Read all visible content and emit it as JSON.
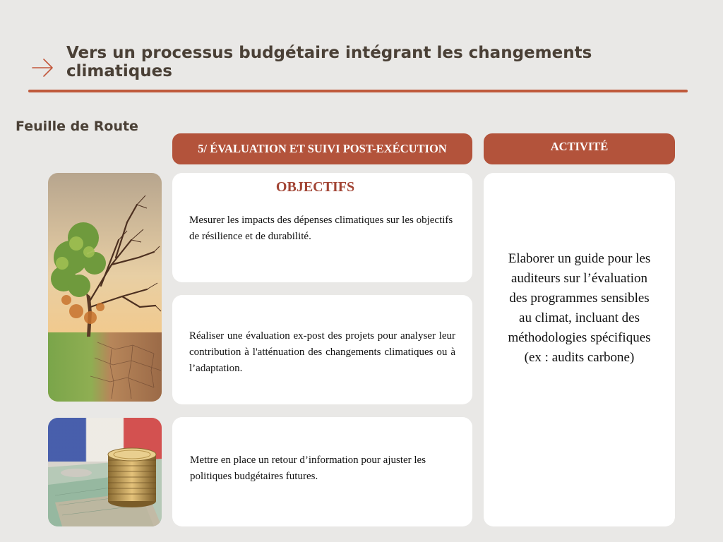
{
  "header": {
    "title": "Vers un processus budgétaire intégrant les changements climatiques",
    "arrow_icon": "arrow-right-icon",
    "accent_color": "#bf5a3c"
  },
  "section": {
    "subtitle": "Feuille de Route"
  },
  "stage": {
    "label": "5/ ÉVALUATION ET SUIVI POST-EXÉCUTION"
  },
  "activity": {
    "label": "ACTIVITÉ",
    "text": "Elaborer un guide pour les auditeurs sur l’évaluation des programmes sensibles au climat, incluant des méthodologies spécifiques (ex : audits carbone)"
  },
  "objectives": {
    "heading": "OBJECTIFS",
    "items": [
      "Mesurer les impacts des dépenses climatiques sur les objectifs de résilience et de durabilité.",
      "Réaliser une évaluation ex-post des projets pour analyser leur contribution à l'atténuation des changements climatiques ou à l’adaptation.",
      "Mettre en place un retour d’information pour ajuster les politiques budgétaires futures."
    ]
  },
  "images": [
    {
      "icon": "climate-tree-image"
    },
    {
      "icon": "coins-banknotes-image"
    }
  ],
  "colors": {
    "background": "#e9e8e6",
    "pill": "#b3533b",
    "card": "#ffffff",
    "title_text": "#4a4036",
    "objectives_heading": "#a24434"
  }
}
